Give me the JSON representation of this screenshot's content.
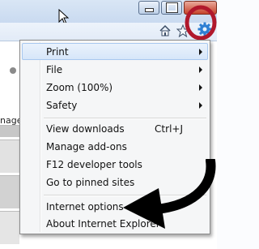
{
  "window": {
    "buttons": [
      {
        "name": "minimize"
      },
      {
        "name": "maximize"
      },
      {
        "name": "close"
      }
    ]
  },
  "toolbar": {
    "icons": [
      "home-icon",
      "favorites-star-icon",
      "tools-gear-icon"
    ]
  },
  "page": {
    "cutoff_text": "nage"
  },
  "menu": {
    "items": [
      {
        "label": "Print",
        "submenu": true
      },
      {
        "label": "File",
        "submenu": true
      },
      {
        "label": "Zoom (100%)",
        "submenu": true
      },
      {
        "label": "Safety",
        "submenu": true
      },
      {
        "label": "View downloads",
        "shortcut": "Ctrl+J"
      },
      {
        "label": "Manage add-ons"
      },
      {
        "label": "F12 developer tools"
      },
      {
        "label": "Go to pinned sites"
      },
      {
        "label": "Internet options"
      },
      {
        "label": "About Internet Explorer"
      }
    ]
  },
  "annotations": {
    "ring_color": "#b0182c",
    "arrow_color": "#000000"
  }
}
